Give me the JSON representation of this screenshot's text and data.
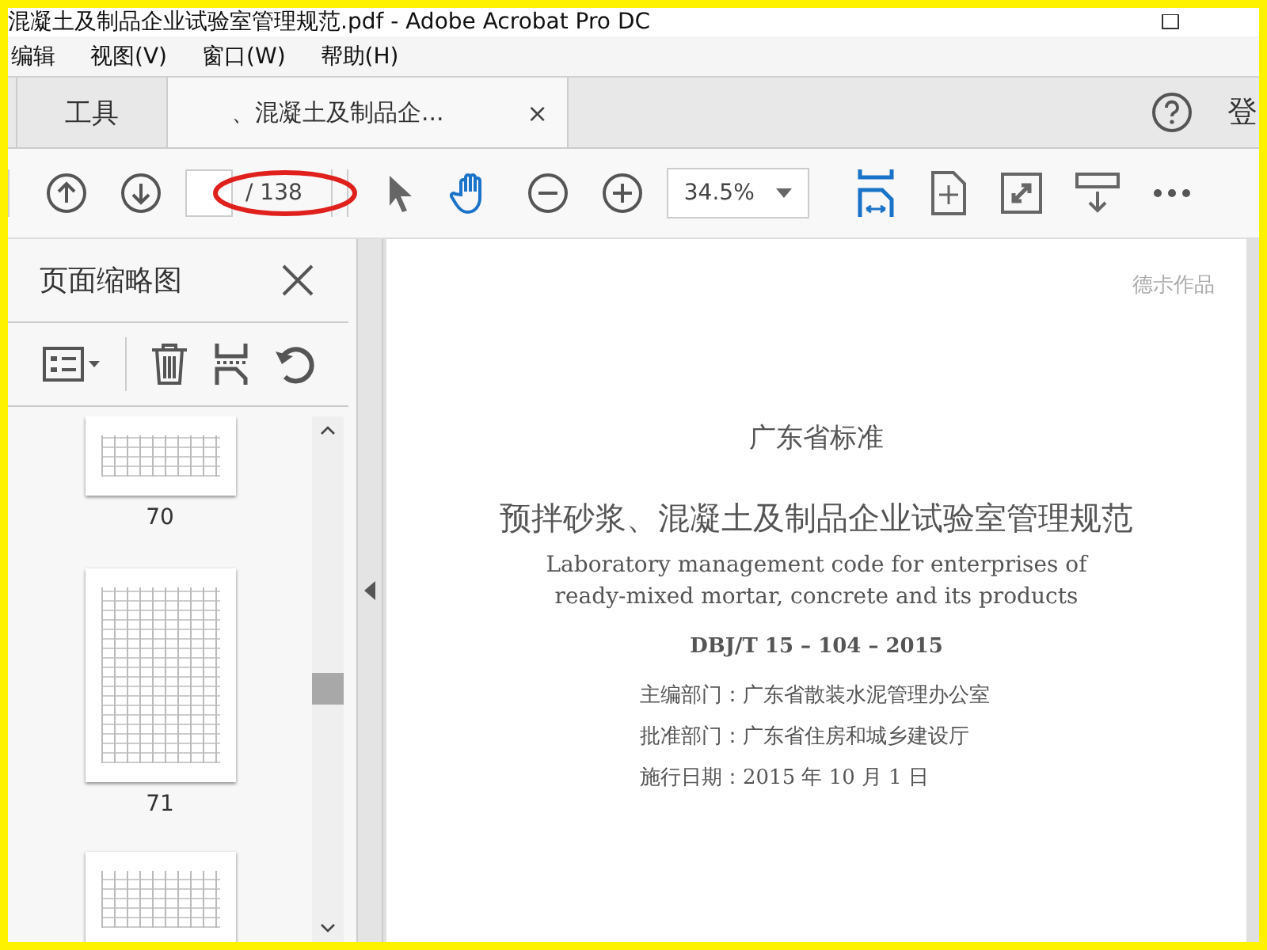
{
  "window": {
    "title": "混凝土及制品企业试验室管理规范.pdf - Adobe Acrobat Pro DC"
  },
  "menu": [
    "编辑",
    "视图(V)",
    "窗口(W)",
    "帮助(H)"
  ],
  "tabs": [
    {
      "label": "工具",
      "kind": "nav",
      "selected": false
    },
    {
      "label": "、混凝土及制品企...",
      "kind": "document",
      "selected": true,
      "close": "×"
    }
  ],
  "account": {
    "label": "登"
  },
  "toolbar": {
    "page_total": "/ 138",
    "zoom": "34.5%"
  },
  "annotation": {
    "kind": "ellipse",
    "color": "#e0201c"
  },
  "thumbnails_panel": {
    "title": "页面缩略图",
    "pages": [
      {
        "label": "70",
        "kind": "partial",
        "selected": false
      },
      {
        "label": "71",
        "kind": "full",
        "selected": false
      },
      {
        "kind": "cut",
        "selected": false
      }
    ]
  },
  "document": {
    "corner_note": "德尗作品",
    "lines": [
      {
        "kind": "heading",
        "text": "广东省标准"
      },
      {
        "kind": "title",
        "text": "预拌砂浆、混凝土及制品企业试验室管理规范"
      },
      {
        "kind": "english",
        "text": "Laboratory management code for enterprises of"
      },
      {
        "kind": "english",
        "text": "ready-mixed mortar, concrete and its products"
      },
      {
        "kind": "code",
        "text": "DBJ/T 15 – 104 – 2015"
      },
      {
        "kind": "info",
        "text": "主编部门：广东省散装水泥管理办公室"
      },
      {
        "kind": "info",
        "text": "批准部门：广东省住房和城乡建设厅"
      },
      {
        "kind": "info",
        "text": "施行日期：2015 年 10 月 1 日"
      }
    ]
  }
}
